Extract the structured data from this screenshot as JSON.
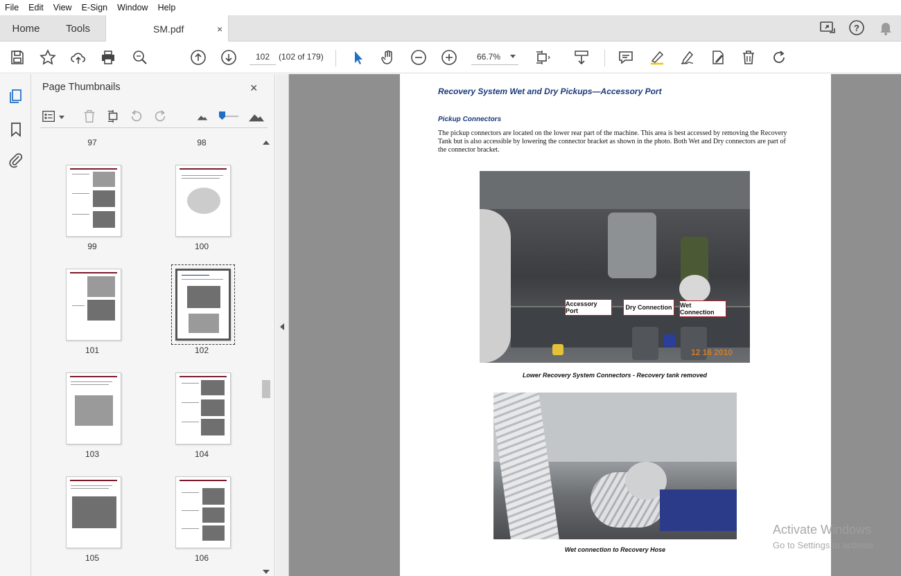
{
  "menu": [
    "File",
    "Edit",
    "View",
    "E-Sign",
    "Window",
    "Help"
  ],
  "tabs": {
    "home": "Home",
    "tools": "Tools",
    "document": "SM.pdf",
    "close": "×"
  },
  "toolbar": {
    "page_number": "102",
    "page_count": "(102 of 179)",
    "zoom": "66.7%"
  },
  "panel": {
    "title": "Page Thumbnails",
    "close": "×",
    "thumbnails": [
      {
        "label": "97"
      },
      {
        "label": "98"
      },
      {
        "label": "99"
      },
      {
        "label": "100"
      },
      {
        "label": "101"
      },
      {
        "label": "102",
        "selected": true
      },
      {
        "label": "103"
      },
      {
        "label": "104"
      },
      {
        "label": "105"
      },
      {
        "label": "106"
      }
    ]
  },
  "document": {
    "heading": "Recovery System Wet and Dry Pickups—Accessory Port",
    "subheading": "Pickup Connectors",
    "paragraph": "The pickup connectors are located on the lower rear part of the machine. This area is best accessed by removing the Recovery Tank but is also accessible by lowering the connector bracket as shown in the photo. Both Wet and Dry connectors are part of the connector bracket.",
    "callouts": [
      "Accessory Port",
      "Dry Connection",
      "Wet Connection"
    ],
    "photo_stamp": "12 16 2010",
    "caption1": "Lower Recovery System Connectors - Recovery tank removed",
    "caption2": "Wet connection to Recovery Hose"
  },
  "watermark": {
    "line1": "Activate Windows",
    "line2": "Go to Settings to activate"
  },
  "colors": {
    "accent": "#1a3a7a",
    "callout_border": "#b0202a",
    "doc_bg": "#8f8f8f"
  }
}
